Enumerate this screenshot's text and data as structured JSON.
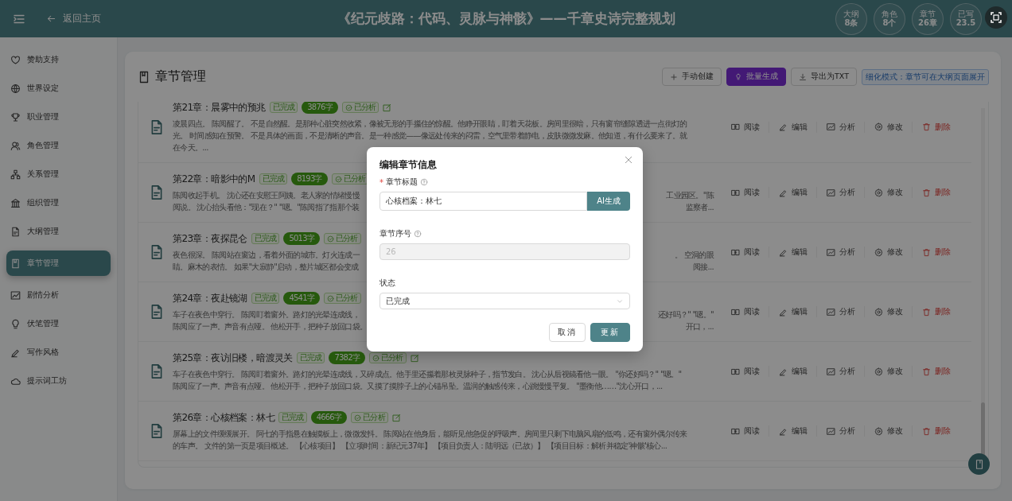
{
  "header": {
    "back_label": "返回主页",
    "title": "《纪元歧路：代码、灵脉与神骸》——千章史诗完整规划",
    "stats": [
      {
        "label": "大纲",
        "value": "8条"
      },
      {
        "label": "角色",
        "value": "8个"
      },
      {
        "label": "章节",
        "value": "26章"
      },
      {
        "label": "已写",
        "value": "23.5"
      }
    ]
  },
  "sidebar": {
    "items": [
      {
        "label": "赞助支持",
        "kind": "heart",
        "selected": false
      },
      {
        "label": "世界设定",
        "kind": "globe",
        "selected": false
      },
      {
        "label": "职业管理",
        "kind": "trophy",
        "selected": false
      },
      {
        "label": "角色管理",
        "kind": "people",
        "selected": false
      },
      {
        "label": "关系管理",
        "kind": "tree",
        "selected": false
      },
      {
        "label": "组织管理",
        "kind": "bank",
        "selected": false
      },
      {
        "label": "大纲管理",
        "kind": "doc",
        "selected": false
      },
      {
        "label": "章节管理",
        "kind": "book",
        "selected": true
      },
      {
        "label": "剧情分析",
        "kind": "chart",
        "selected": false
      },
      {
        "label": "伏笔管理",
        "kind": "bulb",
        "selected": false
      },
      {
        "label": "写作风格",
        "kind": "pen",
        "selected": false
      },
      {
        "label": "提示词工坊",
        "kind": "cloud",
        "selected": false
      }
    ]
  },
  "panel": {
    "title": "章节管理",
    "buttons": [
      {
        "label": "手动创建",
        "kind": "plus",
        "primary": false
      },
      {
        "label": "批量生成",
        "kind": "magic",
        "primary": true
      },
      {
        "label": "导出为TXT",
        "kind": "download",
        "primary": false
      }
    ],
    "mode_tag": "细化模式：章节可在大纲页面展开"
  },
  "chapters": [
    {
      "title": "第21章：晨雾中的预兆",
      "status": "已完成",
      "word_count": "3876字",
      "analysis": "已分析",
      "edit_button": true,
      "excerpt": [
        [
          "凌晨四点。 陈阅醒了。 不是自然醒。是那种心脏突然收紧，像被无形的手攥住的惊醒。他睁开眼睛，盯着天花板。房间里很暗，只有窗帘缝隙透进一点街灯的"
        ],
        [
          "光。 时间感知在预警。 不是具体的画面，不是清晰的声音。是一种感觉——像远处传来的闷雷，空气里带着静电，皮肤微微发麻。他知道，有什么要来了。就"
        ],
        [
          "在今天。..."
        ]
      ],
      "actions": [
        {
          "label": "阅读",
          "kind": "read"
        },
        {
          "label": "编辑",
          "kind": "edit"
        },
        {
          "label": "分析",
          "kind": "analyze"
        },
        {
          "label": "修改",
          "kind": "modify"
        },
        {
          "label": "删除",
          "kind": "delete"
        }
      ]
    },
    {
      "title": "第22章：暗影中的M",
      "status": "已完成",
      "word_count": "8193字",
      "analysis": "已分析",
      "edit_button": false,
      "excerpt": [
        [
          "陈阅收起手机。 沈心还在安慰王阿姨。老人家的情绪慢慢",
          "工业园区。\"陈"
        ],
        [
          "阅说。 沈心抬头看他：\"现在？\" \"嗯。\"陈阅指了指那个装",
          "监察者..."
        ]
      ],
      "actions": [
        {
          "label": "阅读",
          "kind": "read"
        },
        {
          "label": "编辑",
          "kind": "edit"
        },
        {
          "label": "分析",
          "kind": "analyze"
        },
        {
          "label": "修改",
          "kind": "modify"
        },
        {
          "label": "删除",
          "kind": "delete"
        }
      ]
    },
    {
      "title": "第23章：夜探昆仑",
      "status": "已完成",
      "word_count": "5013字",
      "analysis": "已分析",
      "edit_button": false,
      "excerpt": [
        [
          "夜色很深。 陈阅站在窗边，看着外面的城市。灯火连成一",
          "。 空洞的眼"
        ],
        [
          "睛。麻木的表情。 如果\"大寂静\"启动，整片城区都会变成",
          "阅接..."
        ]
      ],
      "actions": [
        {
          "label": "阅读",
          "kind": "read"
        },
        {
          "label": "编辑",
          "kind": "edit"
        },
        {
          "label": "分析",
          "kind": "analyze"
        },
        {
          "label": "修改",
          "kind": "modify"
        },
        {
          "label": "删除",
          "kind": "delete"
        }
      ]
    },
    {
      "title": "第24章：夜赴镜湖",
      "status": "已完成",
      "word_count": "4541字",
      "analysis": "已分析",
      "edit_button": false,
      "excerpt": [
        [
          "车子在夜色中穿行。 陈阅盯着窗外。路灯的光晕连成线，",
          "还好吗？\" \"嗯。\""
        ],
        [
          "陈阅应了一声。声音有点哑。 他松开手，把种子放回口袋。",
          "开口，..."
        ]
      ],
      "actions": [
        {
          "label": "阅读",
          "kind": "read"
        },
        {
          "label": "编辑",
          "kind": "edit"
        },
        {
          "label": "分析",
          "kind": "analyze"
        },
        {
          "label": "修改",
          "kind": "modify"
        },
        {
          "label": "删除",
          "kind": "delete"
        }
      ]
    },
    {
      "title": "第25章：夜访旧楼，暗渡灵关",
      "status": "已完成",
      "word_count": "7382字",
      "analysis": "已分析",
      "edit_button": true,
      "excerpt": [
        [
          "车子在夜色中穿行。 陈阅盯着窗外。路灯的光晕连成线，又碎成点。他手里还攥着那枚灵脉种子，指节发白。 沈心从后视镜看他一眼。 \"你还好吗？\" \"嗯。\""
        ],
        [
          "陈阅应了一声。声音有点哑。 他松开手，把种子放回口袋。又摸了摸脖子上的心锚吊坠。温润的触感传来，心跳慢慢平复。 \"墨衡他……\"沈心开口，..."
        ]
      ],
      "actions": [
        {
          "label": "阅读",
          "kind": "read"
        },
        {
          "label": "编辑",
          "kind": "edit"
        },
        {
          "label": "分析",
          "kind": "analyze"
        },
        {
          "label": "修改",
          "kind": "modify"
        },
        {
          "label": "删除",
          "kind": "delete"
        }
      ]
    },
    {
      "title": "第26章：心核档案：林七",
      "status": "已完成",
      "word_count": "4666字",
      "analysis": "已分析",
      "edit_button": true,
      "excerpt": [
        [
          "屏幕上的文件缓缓展开。 阿七的手指悬在触摸板上，微微发抖。 陈阅站在他身后，能听见他急促的呼吸声。房间里只剩下电脑风扇的低鸣，还有窗外偶尔传来"
        ],
        [
          "的车声。 文件的第一页是项目概述。 【心核项目】 【立项时间：新纪元37年】 【项目负责人：陆明远（已故）】 【项目目标：解析并稳定'神骸'核心..."
        ]
      ],
      "actions": [
        {
          "label": "阅读",
          "kind": "read"
        },
        {
          "label": "编辑",
          "kind": "edit"
        },
        {
          "label": "分析",
          "kind": "analyze"
        },
        {
          "label": "修改",
          "kind": "modify"
        },
        {
          "label": "删除",
          "kind": "delete"
        }
      ]
    }
  ],
  "dialog": {
    "title": "编辑章节信息",
    "fields": [
      {
        "label": "章节标题",
        "kind": "text",
        "required_mark": "*",
        "help": true,
        "disabled": false,
        "value": "心核档案：林七",
        "button": "AI生成"
      },
      {
        "label": "章节序号",
        "kind": "text",
        "help": true,
        "disabled": true,
        "value": "26"
      },
      {
        "label": "状态",
        "kind": "select",
        "help": false,
        "disabled": false,
        "value": "已完成"
      }
    ],
    "buttons": [
      {
        "label": "取消",
        "primary": false
      },
      {
        "label": "更新",
        "primary": true
      }
    ]
  }
}
